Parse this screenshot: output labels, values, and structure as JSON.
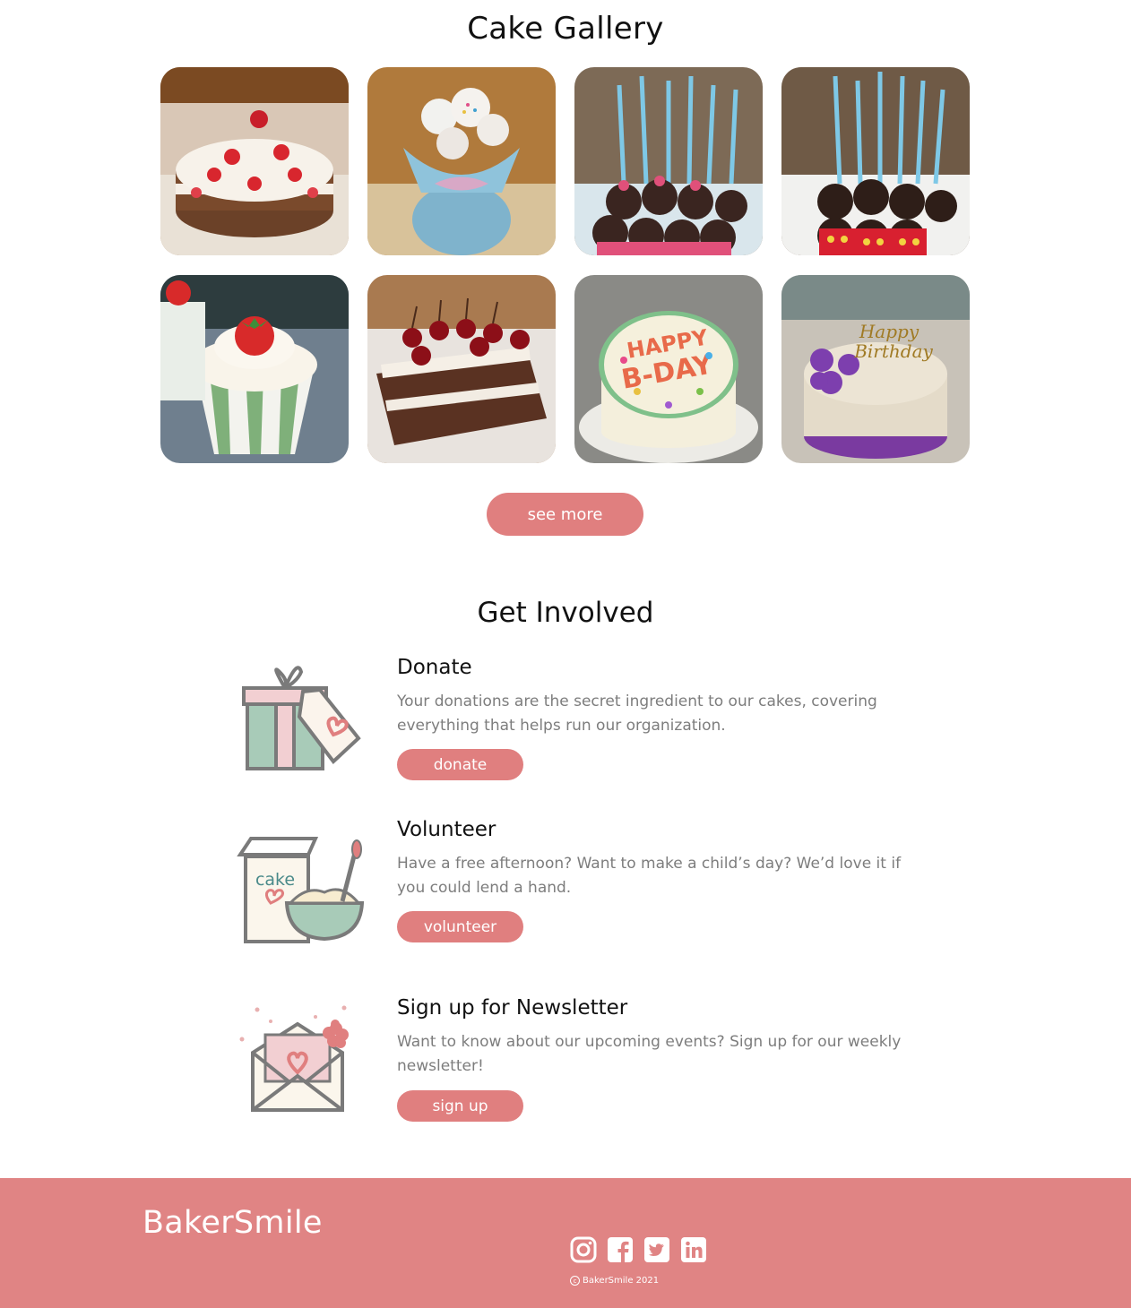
{
  "gallery": {
    "title": "Cake Gallery",
    "images": [
      {
        "name": "strawberry-layer-cake-image"
      },
      {
        "name": "cake-pop-bouquet-image"
      },
      {
        "name": "minnie-cake-pops-image"
      },
      {
        "name": "mickey-cake-pops-image"
      },
      {
        "name": "strawberry-cupcake-image"
      },
      {
        "name": "black-forest-cake-image"
      },
      {
        "name": "happy-bday-cake-image"
      },
      {
        "name": "purple-birthday-cake-image"
      }
    ],
    "see_more_label": "see more"
  },
  "involved": {
    "title": "Get Involved",
    "items": [
      {
        "icon": "gift-icon",
        "title": "Donate",
        "text": "Your donations are the secret ingredient to our cakes, covering everything that helps run our organization.",
        "button": "donate"
      },
      {
        "icon": "cake-mix-bowl-icon",
        "icon_text": "cake",
        "title": "Volunteer",
        "text": "Have a free afternoon? Want to make a child’s day? We’d love it if you could lend a hand.",
        "button": "volunteer"
      },
      {
        "icon": "envelope-heart-icon",
        "title": "Sign up for Newsletter",
        "text": "Want to know about our upcoming events? Sign up for our weekly newsletter!",
        "button": "sign up"
      }
    ]
  },
  "footer": {
    "brand": "BakerSmile",
    "socials": [
      "instagram-icon",
      "facebook-icon",
      "twitter-icon",
      "linkedin-icon"
    ],
    "copyright": "BakerSmile 2021"
  },
  "colors": {
    "accent": "#e07f7f",
    "footer_bg": "#e08484",
    "muted_text": "#7d7d7d"
  }
}
